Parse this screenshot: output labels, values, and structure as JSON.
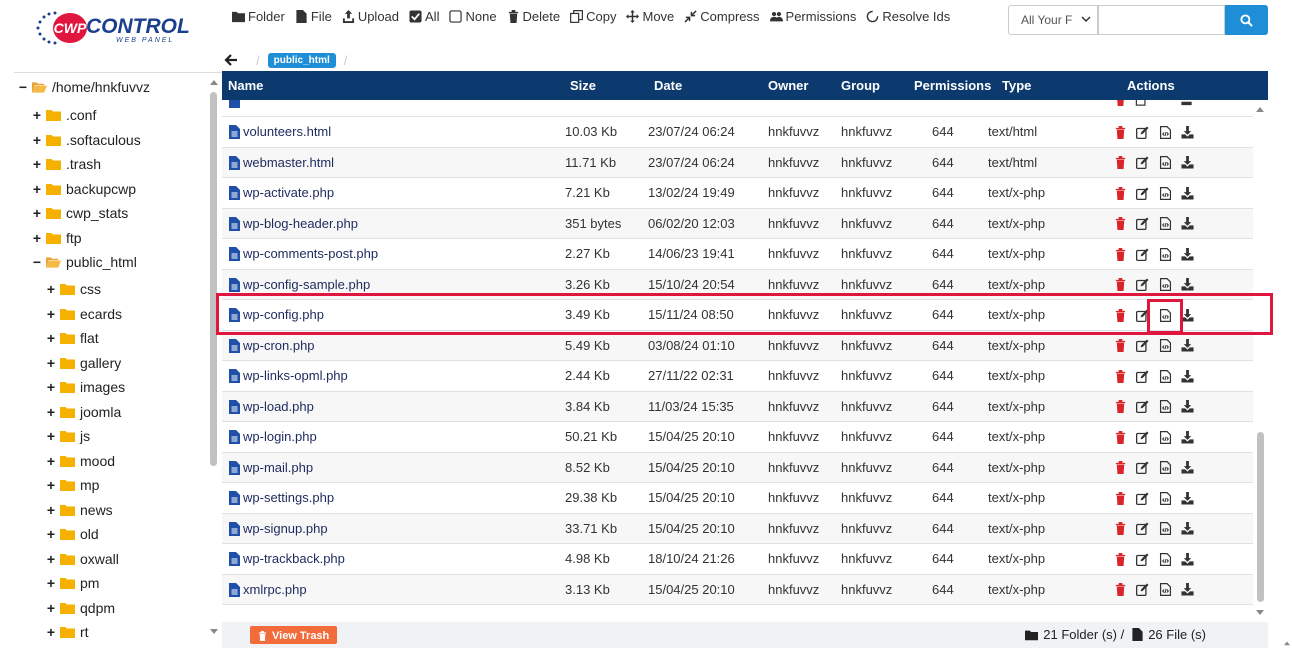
{
  "brand": {
    "logo_main": "CONTROL",
    "logo_prefix": "CWP",
    "logo_sub": "WEB PANEL"
  },
  "toolbar": {
    "folder": "Folder",
    "file": "File",
    "upload": "Upload",
    "all": "All",
    "none": "None",
    "delete": "Delete",
    "copy": "Copy",
    "move": "Move",
    "compress": "Compress",
    "permissions": "Permissions",
    "resolve_ids": "Resolve Ids"
  },
  "search": {
    "scope": "All Your F",
    "placeholder": ""
  },
  "sidebar": {
    "root": "/home/hnkfuvvz",
    "items": [
      ".conf",
      ".softaculous",
      ".trash",
      "backupcwp",
      "cwp_stats",
      "ftp"
    ],
    "open_folder": "public_html",
    "subitems": [
      "css",
      "ecards",
      "flat",
      "gallery",
      "images",
      "joomla",
      "js",
      "mood",
      "mp",
      "news",
      "old",
      "oxwall",
      "pm",
      "qdpm",
      "rt"
    ]
  },
  "breadcrumb": {
    "current": "public_html",
    "separator": "/"
  },
  "table": {
    "headers": {
      "name": "Name",
      "size": "Size",
      "date": "Date",
      "owner": "Owner",
      "group": "Group",
      "permissions": "Permissions",
      "type": "Type",
      "actions": "Actions"
    },
    "rows": [
      {
        "name": "volunteers.html",
        "size": "10.03 Kb",
        "date": "23/07/24 06:24",
        "owner": "hnkfuvvz",
        "group": "hnkfuvvz",
        "perms": "644",
        "type": "text/html"
      },
      {
        "name": "webmaster.html",
        "size": "11.71 Kb",
        "date": "23/07/24 06:24",
        "owner": "hnkfuvvz",
        "group": "hnkfuvvz",
        "perms": "644",
        "type": "text/html"
      },
      {
        "name": "wp-activate.php",
        "size": "7.21 Kb",
        "date": "13/02/24 19:49",
        "owner": "hnkfuvvz",
        "group": "hnkfuvvz",
        "perms": "644",
        "type": "text/x-php"
      },
      {
        "name": "wp-blog-header.php",
        "size": "351 bytes",
        "date": "06/02/20 12:03",
        "owner": "hnkfuvvz",
        "group": "hnkfuvvz",
        "perms": "644",
        "type": "text/x-php"
      },
      {
        "name": "wp-comments-post.php",
        "size": "2.27 Kb",
        "date": "14/06/23 19:41",
        "owner": "hnkfuvvz",
        "group": "hnkfuvvz",
        "perms": "644",
        "type": "text/x-php"
      },
      {
        "name": "wp-config-sample.php",
        "size": "3.26 Kb",
        "date": "15/10/24 20:54",
        "owner": "hnkfuvvz",
        "group": "hnkfuvvz",
        "perms": "644",
        "type": "text/x-php"
      },
      {
        "name": "wp-config.php",
        "size": "3.49 Kb",
        "date": "15/11/24 08:50",
        "owner": "hnkfuvvz",
        "group": "hnkfuvvz",
        "perms": "644",
        "type": "text/x-php"
      },
      {
        "name": "wp-cron.php",
        "size": "5.49 Kb",
        "date": "03/08/24 01:10",
        "owner": "hnkfuvvz",
        "group": "hnkfuvvz",
        "perms": "644",
        "type": "text/x-php"
      },
      {
        "name": "wp-links-opml.php",
        "size": "2.44 Kb",
        "date": "27/11/22 02:31",
        "owner": "hnkfuvvz",
        "group": "hnkfuvvz",
        "perms": "644",
        "type": "text/x-php"
      },
      {
        "name": "wp-load.php",
        "size": "3.84 Kb",
        "date": "11/03/24 15:35",
        "owner": "hnkfuvvz",
        "group": "hnkfuvvz",
        "perms": "644",
        "type": "text/x-php"
      },
      {
        "name": "wp-login.php",
        "size": "50.21 Kb",
        "date": "15/04/25 20:10",
        "owner": "hnkfuvvz",
        "group": "hnkfuvvz",
        "perms": "644",
        "type": "text/x-php"
      },
      {
        "name": "wp-mail.php",
        "size": "8.52 Kb",
        "date": "15/04/25 20:10",
        "owner": "hnkfuvvz",
        "group": "hnkfuvvz",
        "perms": "644",
        "type": "text/x-php"
      },
      {
        "name": "wp-settings.php",
        "size": "29.38 Kb",
        "date": "15/04/25 20:10",
        "owner": "hnkfuvvz",
        "group": "hnkfuvvz",
        "perms": "644",
        "type": "text/x-php"
      },
      {
        "name": "wp-signup.php",
        "size": "33.71 Kb",
        "date": "15/04/25 20:10",
        "owner": "hnkfuvvz",
        "group": "hnkfuvvz",
        "perms": "644",
        "type": "text/x-php"
      },
      {
        "name": "wp-trackback.php",
        "size": "4.98 Kb",
        "date": "18/10/24 21:26",
        "owner": "hnkfuvvz",
        "group": "hnkfuvvz",
        "perms": "644",
        "type": "text/x-php"
      },
      {
        "name": "xmlrpc.php",
        "size": "3.13 Kb",
        "date": "15/04/25 20:10",
        "owner": "hnkfuvvz",
        "group": "hnkfuvvz",
        "perms": "644",
        "type": "text/x-php"
      }
    ],
    "highlighted_row": "wp-config.php",
    "highlighted_action": "edit-code-icon"
  },
  "footer": {
    "view_trash": "View Trash",
    "folders_count": "21 Folder (s) /",
    "files_count": "26 File (s)"
  },
  "colors": {
    "header_bg": "#0c3a6e",
    "accent_blue": "#1e8fd6",
    "trash_orange": "#f26b3a",
    "delete_red": "#d9242a",
    "highlight_red": "#e0163f"
  },
  "icons": {
    "actions": [
      "trash-icon",
      "edit-icon",
      "edit-code-icon",
      "download-icon"
    ],
    "file": "file-icon",
    "folder": "folder-icon"
  }
}
